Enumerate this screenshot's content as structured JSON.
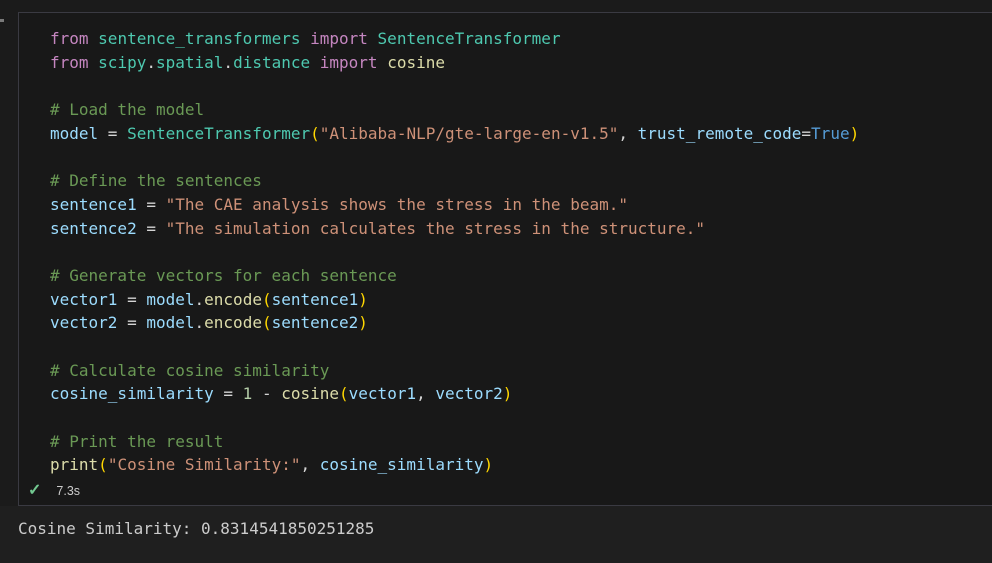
{
  "palette": {
    "background": "#1b1b1b",
    "cell_background": "#181818",
    "output_background": "#1f1f1f",
    "cell_border": "#3a3a42",
    "keyword": "#C586C0",
    "type": "#4EC9B0",
    "function": "#DCDCAA",
    "variable": "#9CDCFE",
    "operator": "#D4D4D4",
    "string": "#CE9178",
    "number": "#B5CEA8",
    "boolean": "#569CD6",
    "comment": "#6A9955",
    "bracket": "#FFD700",
    "success_check": "#73C991",
    "output_text": "#cccccc"
  },
  "cell": {
    "language": "python",
    "code_lines": [
      {
        "tokens": [
          {
            "t": "from",
            "s": "kw"
          },
          {
            "t": " ",
            "s": "op"
          },
          {
            "t": "sentence_transformers",
            "s": "ty"
          },
          {
            "t": " ",
            "s": "op"
          },
          {
            "t": "import",
            "s": "kw"
          },
          {
            "t": " ",
            "s": "op"
          },
          {
            "t": "SentenceTransformer",
            "s": "ty"
          }
        ]
      },
      {
        "tokens": [
          {
            "t": "from",
            "s": "kw"
          },
          {
            "t": " ",
            "s": "op"
          },
          {
            "t": "scipy",
            "s": "ty"
          },
          {
            "t": ".",
            "s": "op"
          },
          {
            "t": "spatial",
            "s": "ty"
          },
          {
            "t": ".",
            "s": "op"
          },
          {
            "t": "distance",
            "s": "ty"
          },
          {
            "t": " ",
            "s": "op"
          },
          {
            "t": "import",
            "s": "kw"
          },
          {
            "t": " ",
            "s": "op"
          },
          {
            "t": "cosine",
            "s": "fn"
          }
        ]
      },
      {
        "tokens": []
      },
      {
        "tokens": [
          {
            "t": "# Load the model",
            "s": "com"
          }
        ]
      },
      {
        "tokens": [
          {
            "t": "model",
            "s": "var"
          },
          {
            "t": " = ",
            "s": "op"
          },
          {
            "t": "SentenceTransformer",
            "s": "ty"
          },
          {
            "t": "(",
            "s": "br"
          },
          {
            "t": "\"Alibaba-NLP/gte-large-en-v1.5\"",
            "s": "str"
          },
          {
            "t": ", ",
            "s": "op"
          },
          {
            "t": "trust_remote_code",
            "s": "var"
          },
          {
            "t": "=",
            "s": "op"
          },
          {
            "t": "True",
            "s": "bool"
          },
          {
            "t": ")",
            "s": "br"
          }
        ]
      },
      {
        "tokens": []
      },
      {
        "tokens": [
          {
            "t": "# Define the sentences",
            "s": "com"
          }
        ]
      },
      {
        "tokens": [
          {
            "t": "sentence1",
            "s": "var"
          },
          {
            "t": " = ",
            "s": "op"
          },
          {
            "t": "\"The CAE analysis shows the stress in the beam.\"",
            "s": "str"
          }
        ]
      },
      {
        "tokens": [
          {
            "t": "sentence2",
            "s": "var"
          },
          {
            "t": " = ",
            "s": "op"
          },
          {
            "t": "\"The simulation calculates the stress in the structure.\"",
            "s": "str"
          }
        ]
      },
      {
        "tokens": []
      },
      {
        "tokens": [
          {
            "t": "# Generate vectors for each sentence",
            "s": "com"
          }
        ]
      },
      {
        "tokens": [
          {
            "t": "vector1",
            "s": "var"
          },
          {
            "t": " = ",
            "s": "op"
          },
          {
            "t": "model",
            "s": "var"
          },
          {
            "t": ".",
            "s": "op"
          },
          {
            "t": "encode",
            "s": "fn"
          },
          {
            "t": "(",
            "s": "br"
          },
          {
            "t": "sentence1",
            "s": "var"
          },
          {
            "t": ")",
            "s": "br"
          }
        ]
      },
      {
        "tokens": [
          {
            "t": "vector2",
            "s": "var"
          },
          {
            "t": " = ",
            "s": "op"
          },
          {
            "t": "model",
            "s": "var"
          },
          {
            "t": ".",
            "s": "op"
          },
          {
            "t": "encode",
            "s": "fn"
          },
          {
            "t": "(",
            "s": "br"
          },
          {
            "t": "sentence2",
            "s": "var"
          },
          {
            "t": ")",
            "s": "br"
          }
        ]
      },
      {
        "tokens": []
      },
      {
        "tokens": [
          {
            "t": "# Calculate cosine similarity",
            "s": "com"
          }
        ]
      },
      {
        "tokens": [
          {
            "t": "cosine_similarity",
            "s": "var"
          },
          {
            "t": " = ",
            "s": "op"
          },
          {
            "t": "1",
            "s": "num"
          },
          {
            "t": " - ",
            "s": "op"
          },
          {
            "t": "cosine",
            "s": "fn"
          },
          {
            "t": "(",
            "s": "br"
          },
          {
            "t": "vector1",
            "s": "var"
          },
          {
            "t": ", ",
            "s": "op"
          },
          {
            "t": "vector2",
            "s": "var"
          },
          {
            "t": ")",
            "s": "br"
          }
        ]
      },
      {
        "tokens": []
      },
      {
        "tokens": [
          {
            "t": "# Print the result",
            "s": "com"
          }
        ]
      },
      {
        "tokens": [
          {
            "t": "print",
            "s": "fn"
          },
          {
            "t": "(",
            "s": "br"
          },
          {
            "t": "\"Cosine Similarity:\"",
            "s": "str"
          },
          {
            "t": ", ",
            "s": "op"
          },
          {
            "t": "cosine_similarity",
            "s": "var"
          },
          {
            "t": ")",
            "s": "br"
          }
        ]
      }
    ],
    "execution": {
      "status_icon": "check-icon",
      "status_glyph": "✓",
      "duration": "7.3s"
    },
    "output": {
      "text": "Cosine Similarity: 0.8314541850251285"
    }
  }
}
